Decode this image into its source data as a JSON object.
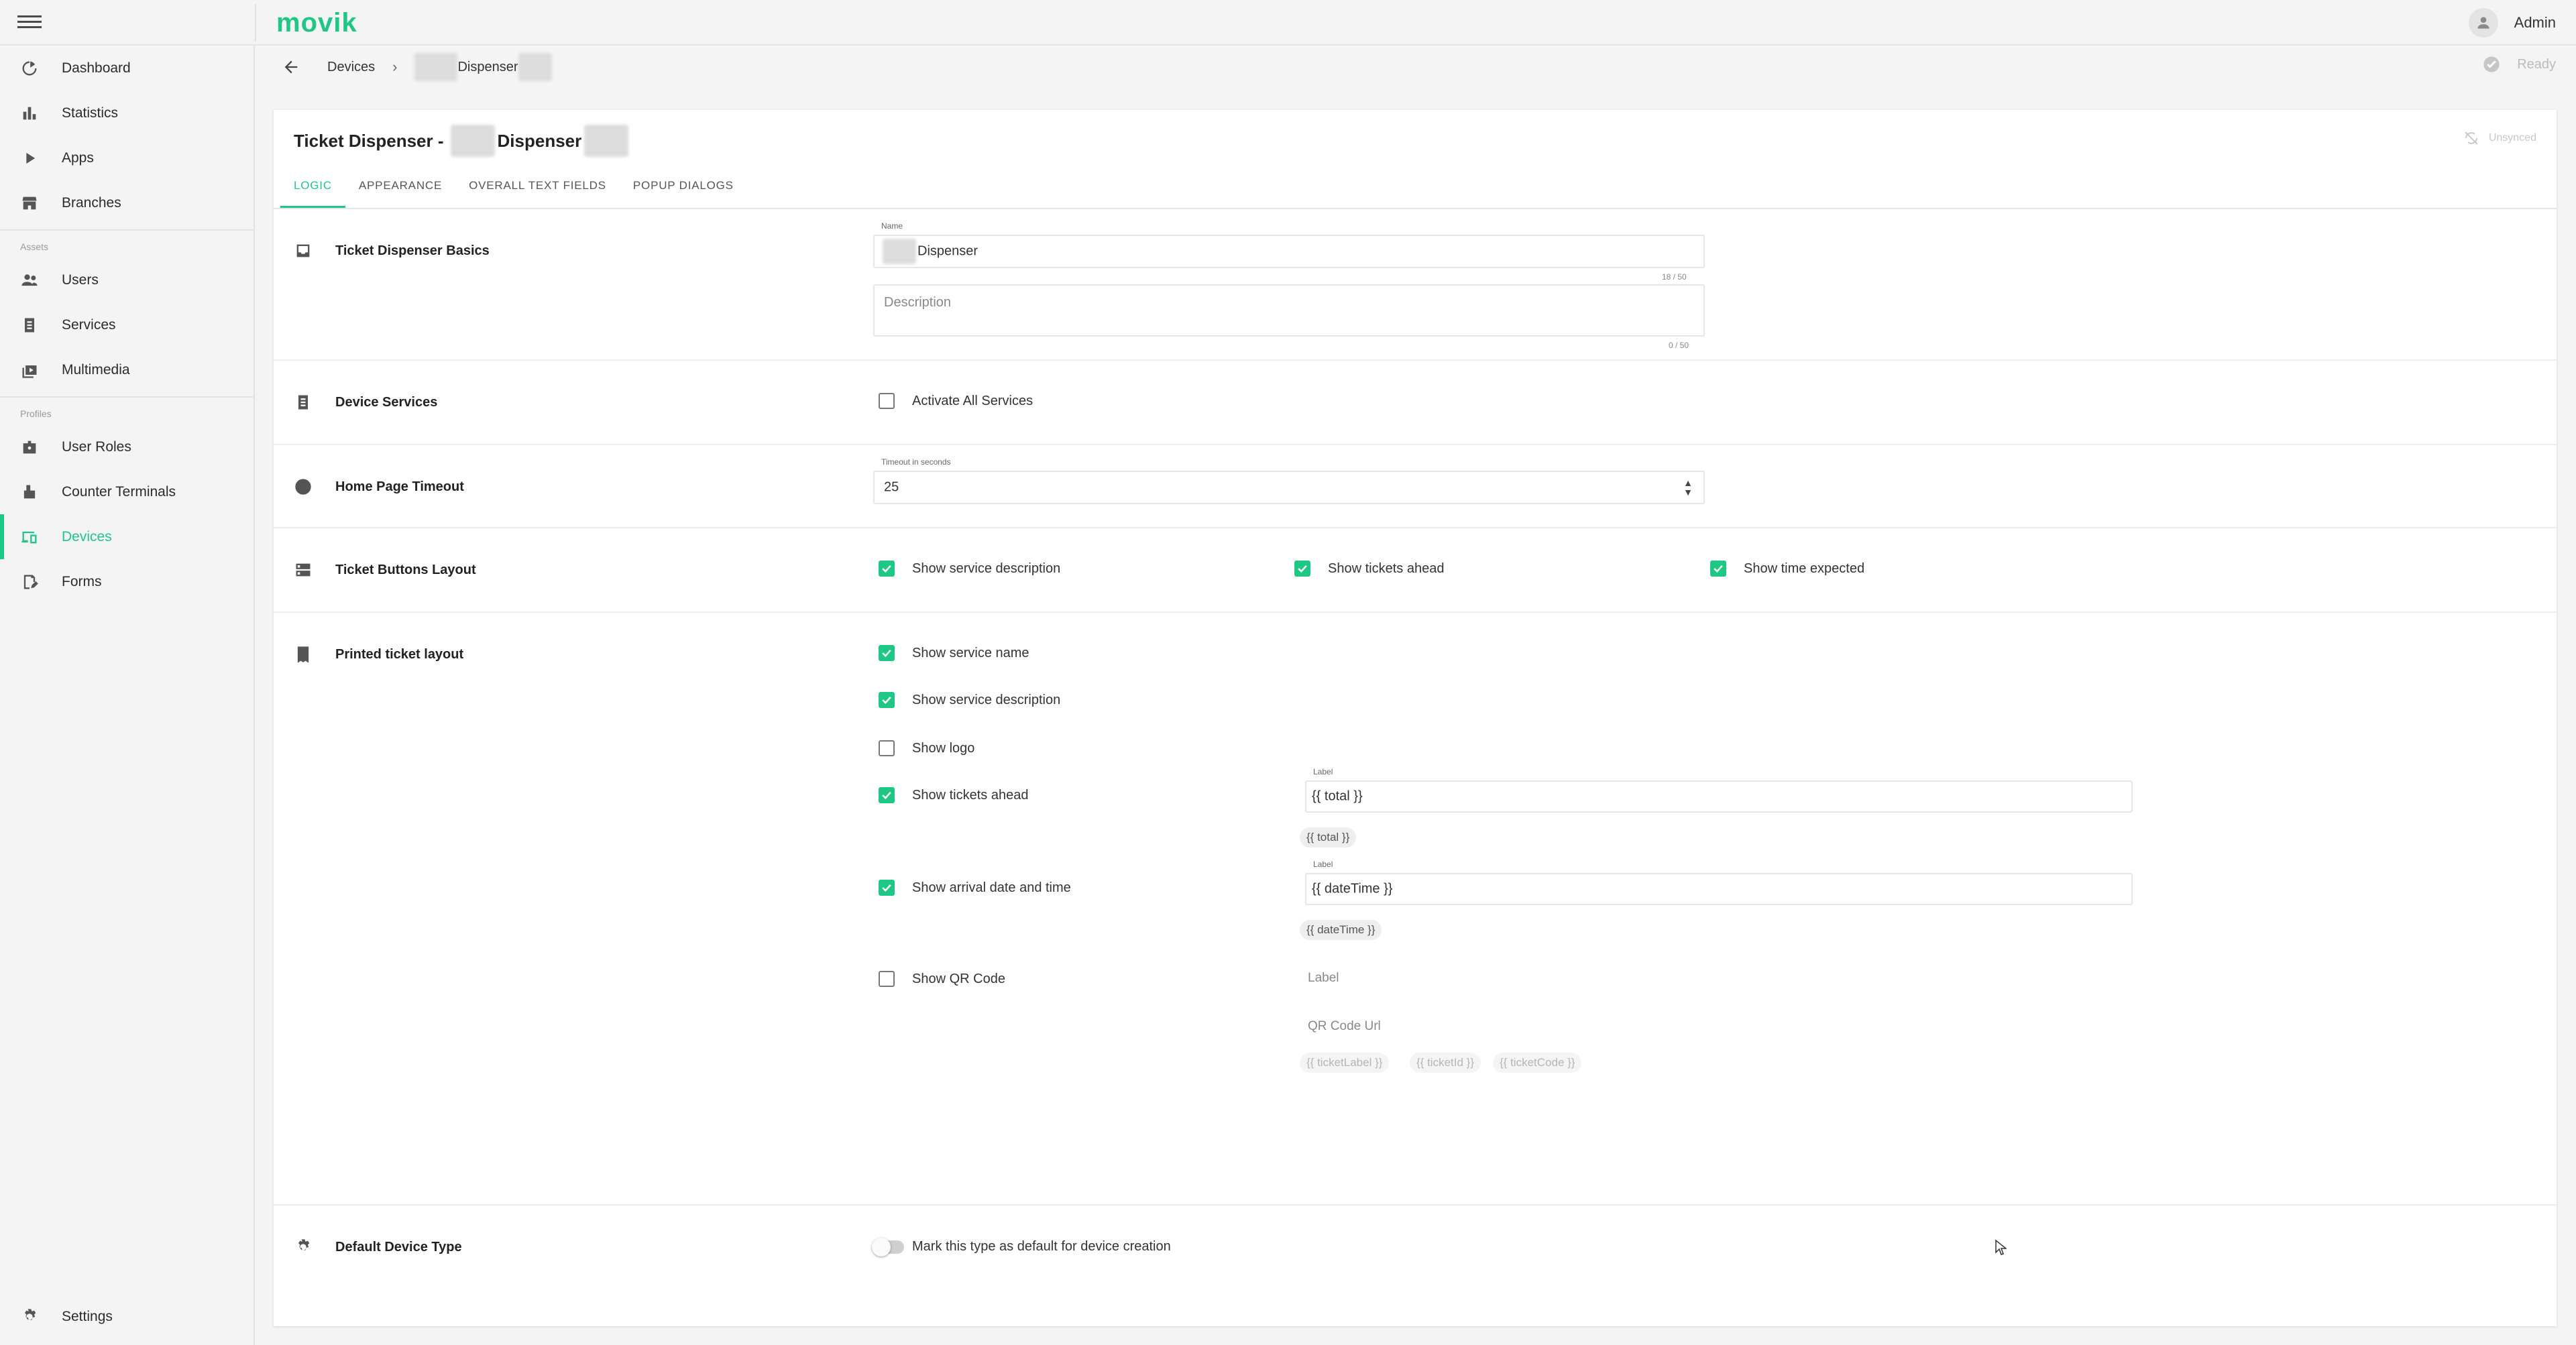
{
  "app": {
    "logo": "movik",
    "user": "Admin"
  },
  "sidebar": {
    "items_main": [
      {
        "label": "Dashboard",
        "icon": "dashboard-icon"
      },
      {
        "label": "Statistics",
        "icon": "bar-chart-icon"
      },
      {
        "label": "Apps",
        "icon": "play-icon"
      },
      {
        "label": "Branches",
        "icon": "store-icon"
      }
    ],
    "assets_label": "Assets",
    "items_assets": [
      {
        "label": "Users",
        "icon": "users-icon"
      },
      {
        "label": "Services",
        "icon": "clipboard-icon"
      },
      {
        "label": "Multimedia",
        "icon": "multimedia-icon"
      }
    ],
    "profiles_label": "Profiles",
    "items_profiles": [
      {
        "label": "User Roles",
        "icon": "badge-icon"
      },
      {
        "label": "Counter Terminals",
        "icon": "terminal-icon"
      },
      {
        "label": "Devices",
        "icon": "devices-icon"
      },
      {
        "label": "Forms",
        "icon": "form-icon"
      }
    ],
    "settings": "Settings"
  },
  "breadcrumb": {
    "root": "Devices",
    "current": "Dispenser"
  },
  "status": {
    "ready": "Ready",
    "unsynced": "Unsynced"
  },
  "card": {
    "title_prefix": "Ticket Dispenser -",
    "title_name": "Dispenser",
    "tabs": [
      "Logic",
      "Appearance",
      "Overall Text Fields",
      "Popup Dialogs"
    ]
  },
  "basics": {
    "title": "Ticket Dispenser Basics",
    "name_label": "Name",
    "name_value": "Dispenser",
    "name_counter": "18 / 50",
    "description_placeholder": "Description",
    "description_counter": "0 / 50"
  },
  "services": {
    "title": "Device Services",
    "activate_all": "Activate All Services"
  },
  "timeout": {
    "title": "Home Page Timeout",
    "label": "Timeout in seconds",
    "value": "25"
  },
  "buttons_layout": {
    "title": "Ticket Buttons Layout",
    "show_description": "Show service description",
    "show_tickets_ahead": "Show tickets ahead",
    "show_time_expected": "Show time expected"
  },
  "printed": {
    "title": "Printed ticket layout",
    "show_service_name": "Show service name",
    "show_service_description": "Show service description",
    "show_logo": "Show logo",
    "show_tickets_ahead": "Show tickets ahead",
    "tickets_ahead_label": "Label",
    "tickets_ahead_value": "{{ total }}",
    "tickets_ahead_chip": "{{ total }}",
    "show_arrival": "Show arrival date and time",
    "arrival_label": "Label",
    "arrival_value": "{{ dateTime }}",
    "arrival_chip": "{{ dateTime }}",
    "show_qr": "Show QR Code",
    "qr_label": "Label",
    "qr_url": "QR Code Url",
    "qr_chips": [
      "{{ ticketLabel }}",
      "{{ ticketId }}",
      "{{ ticketCode }}"
    ]
  },
  "default_type": {
    "title": "Default Device Type",
    "toggle_label": "Mark this type as default for device creation"
  },
  "colors": {
    "accent": "#1fc784"
  }
}
